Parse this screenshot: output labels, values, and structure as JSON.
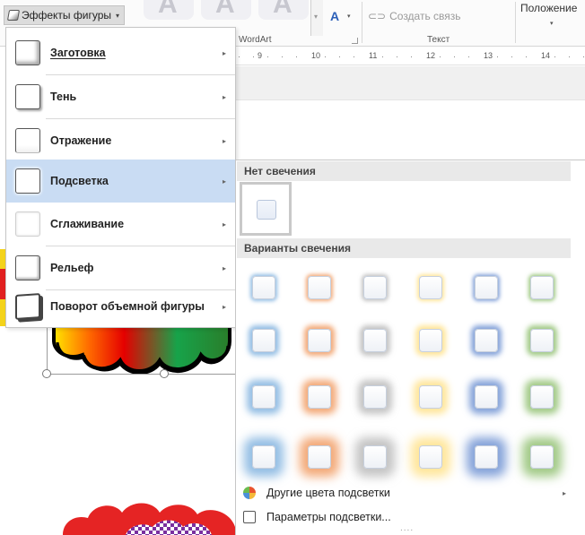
{
  "ribbon": {
    "effects_label": "Эффекты фигуры",
    "effects_caret": "▾",
    "wordart_group": "WordArt",
    "text_group": "Текст",
    "create_link": "Создать связь",
    "position_label": "Положение",
    "text_fill_glyph": "A",
    "wordart_style_glyph": "A"
  },
  "ruler": {
    "numbers": [
      "9",
      "10",
      "11",
      "12",
      "13",
      "14"
    ]
  },
  "menu": {
    "items": [
      {
        "label": "Заготовка",
        "icon": "preset-icon",
        "has_submenu": true
      },
      {
        "label": "Тень",
        "icon": "shadow-icon",
        "has_submenu": true
      },
      {
        "label": "Отражение",
        "icon": "reflection-icon",
        "has_submenu": true
      },
      {
        "label": "Подсветка",
        "icon": "glow-icon",
        "has_submenu": true,
        "active": true
      },
      {
        "label": "Сглаживание",
        "icon": "soft-edges-icon",
        "has_submenu": true
      },
      {
        "label": "Рельеф",
        "icon": "bevel-icon",
        "has_submenu": true
      },
      {
        "label": "Поворот объемной фигуры",
        "icon": "3d-rotation-icon",
        "has_submenu": true
      }
    ],
    "arrow": "▸"
  },
  "gallery": {
    "no_glow_header": "Нет свечения",
    "variants_header": "Варианты свечения",
    "glow_colors": [
      "#5b9bd5",
      "#ed7d31",
      "#a5a5a5",
      "#ffd966",
      "#4472c4",
      "#70ad47"
    ],
    "glow_rows": 4,
    "more_colors": "Другие цвета подсветки",
    "options": "Параметры подсветки...",
    "grip": "....",
    "accent": "#c9dcf3"
  }
}
